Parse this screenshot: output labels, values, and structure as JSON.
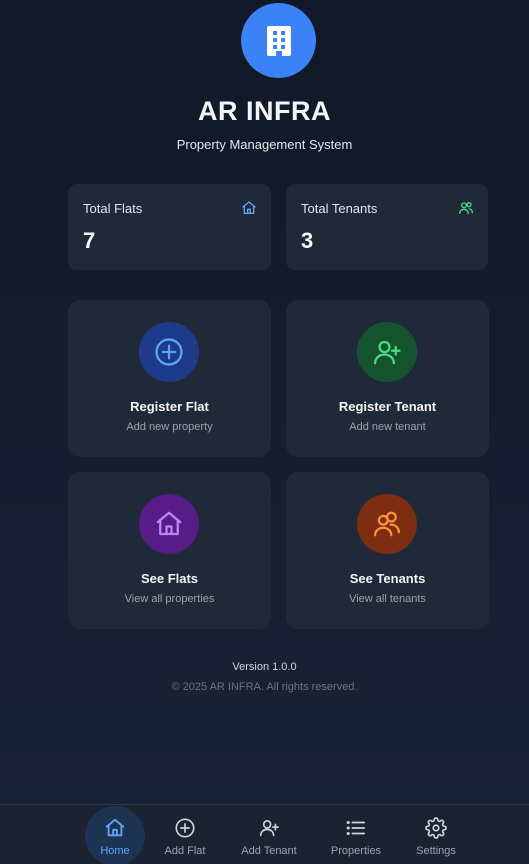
{
  "header": {
    "logo_icon": "building-icon",
    "title": "AR INFRA",
    "subtitle": "Property Management System"
  },
  "stats": [
    {
      "label": "Total Flats",
      "value": "7",
      "icon": "home-icon",
      "color": "#60a5fa"
    },
    {
      "label": "Total Tenants",
      "value": "3",
      "icon": "users-icon",
      "color": "#4ade80"
    }
  ],
  "actions": [
    {
      "title": "Register Flat",
      "subtitle": "Add new property",
      "icon": "plus-circle-icon",
      "bg": "#1e3a8a",
      "fg": "#60a5fa"
    },
    {
      "title": "Register Tenant",
      "subtitle": "Add new tenant",
      "icon": "user-plus-icon",
      "bg": "#14532d",
      "fg": "#4ade80"
    },
    {
      "title": "See Flats",
      "subtitle": "View all properties",
      "icon": "home-icon",
      "bg": "#581c87",
      "fg": "#c084fc"
    },
    {
      "title": "See Tenants",
      "subtitle": "View all tenants",
      "icon": "users-icon",
      "bg": "#7c2d12",
      "fg": "#fb923c"
    }
  ],
  "footer": {
    "version": "Version 1.0.0",
    "copyright": "© 2025 AR INFRA. All rights reserved."
  },
  "nav": {
    "items": [
      {
        "label": "Home",
        "icon": "home-icon",
        "active": true
      },
      {
        "label": "Add Flat",
        "icon": "plus-circle-icon"
      },
      {
        "label": "Add Tenant",
        "icon": "user-plus-icon"
      },
      {
        "label": "Properties",
        "icon": "list-icon"
      },
      {
        "label": "Settings",
        "icon": "gear-icon"
      }
    ]
  },
  "colors": {
    "accent": "#3b82f6",
    "background": "#111827",
    "card": "#1f2937"
  }
}
